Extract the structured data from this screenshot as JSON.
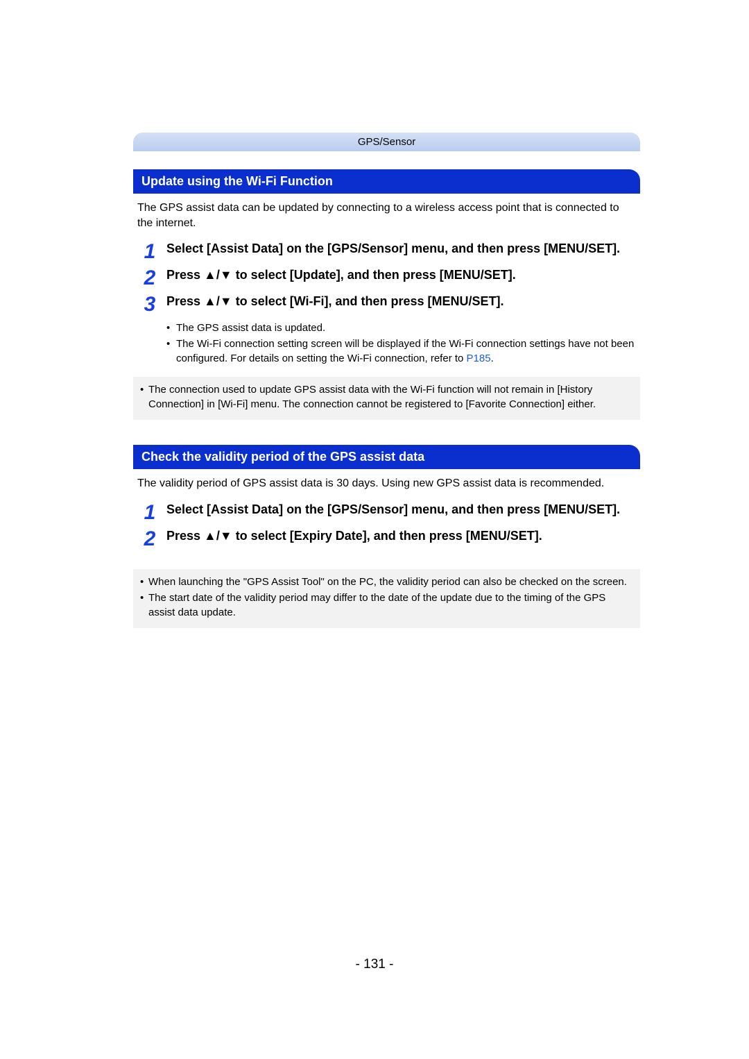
{
  "header_category": "GPS/Sensor",
  "section1": {
    "title": "Update using the Wi-Fi Function",
    "intro": "The GPS assist data can be updated by connecting to a wireless access point that is connected to the internet.",
    "steps": [
      {
        "num": "1",
        "text": "Select [Assist Data] on the [GPS/Sensor] menu, and then press [MENU/SET]."
      },
      {
        "num": "2",
        "text_pre": "Press ",
        "text_post": " to select [Update], and then press [MENU/SET]."
      },
      {
        "num": "3",
        "text_pre": "Press ",
        "text_post": " to select [Wi-Fi], and then press [MENU/SET]."
      }
    ],
    "sub_bullets": [
      "The GPS assist data is updated.",
      "The Wi-Fi connection setting screen will be displayed if the Wi-Fi connection settings have not been configured. For details on setting the Wi-Fi connection, refer to "
    ],
    "sub_link": "P185",
    "notes": [
      "The connection used to update GPS assist data with the Wi-Fi function will not remain in [History Connection] in [Wi-Fi] menu. The connection cannot be registered to [Favorite Connection] either."
    ]
  },
  "section2": {
    "title": "Check the validity period of the GPS assist data",
    "intro": "The validity period of GPS assist data is 30 days. Using new GPS assist data is recommended.",
    "steps": [
      {
        "num": "1",
        "text": "Select [Assist Data] on the [GPS/Sensor] menu, and then press [MENU/SET]."
      },
      {
        "num": "2",
        "text_pre": "Press ",
        "text_post": " to select [Expiry Date], and then press [MENU/SET]."
      }
    ],
    "notes": [
      "When launching the \"GPS Assist Tool\" on the PC, the validity period can also be checked on the screen.",
      "The start date of the validity period may differ to the date of the update due to the timing of the GPS assist data update."
    ]
  },
  "page_number": "- 131 -",
  "arrows": "▲/▼"
}
